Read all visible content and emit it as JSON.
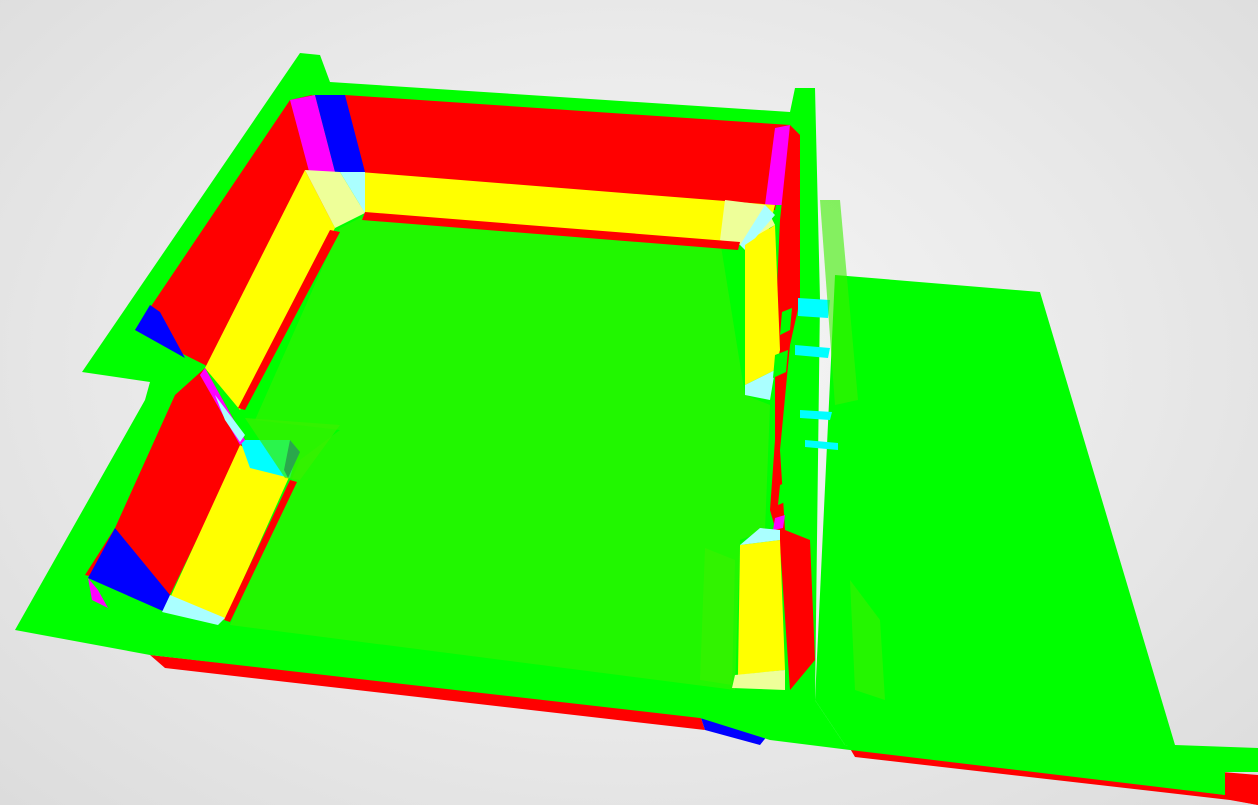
{
  "viewer": {
    "background": "#e6e6e6"
  },
  "colors": {
    "floor": "#00ff00",
    "floor_shade": "#3cf000",
    "wall_face_x": "#ff0000",
    "wall_face_y": "#ffff00",
    "wall_face_z": "#0000ff",
    "bevel_magenta": "#ff00ff",
    "bevel_cyan": "#00ffff",
    "bevel_light_cyan": "#aaffff",
    "bevel_light_yellow": "#eeff99"
  },
  "scene": {
    "type": "3d-normal-colored-floorplan",
    "objects": [
      "floor-slab",
      "left-wall",
      "back-wall",
      "partition-wall",
      "right-room-floor",
      "slab-edge"
    ]
  }
}
